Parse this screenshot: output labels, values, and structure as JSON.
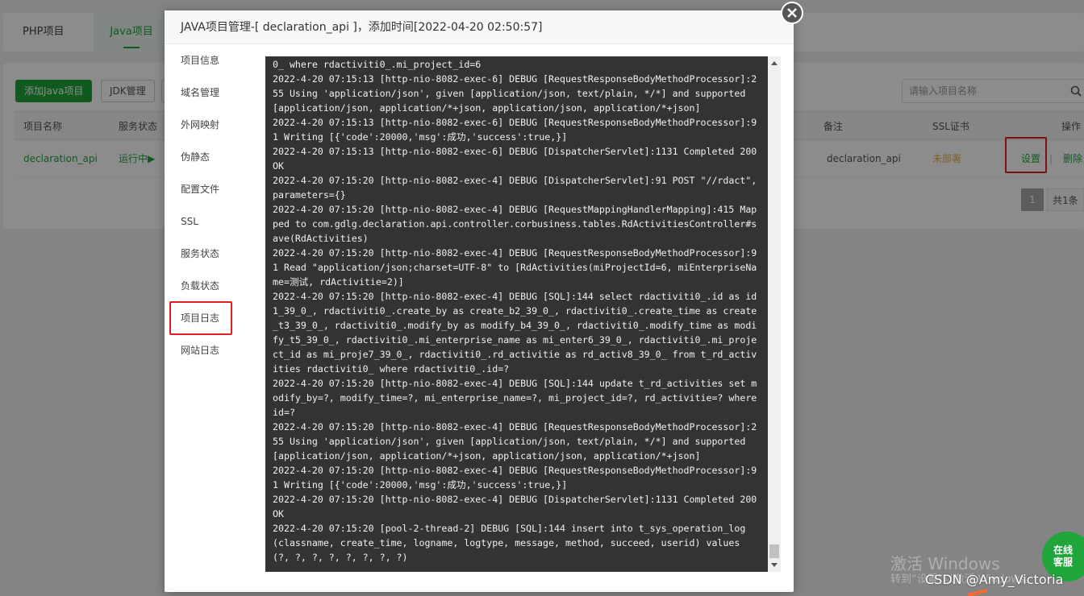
{
  "tabs": {
    "php": "PHP项目",
    "java": "Java项目"
  },
  "toolbar": {
    "add_java": "添加Java项目",
    "jdk": "JDK管理"
  },
  "search": {
    "placeholder": "请输入项目名称"
  },
  "table": {
    "headers": {
      "name": "项目名称",
      "status": "服务状态",
      "remark": "备注",
      "ssl": "SSL证书",
      "actions": "操作"
    },
    "row": {
      "name": "declaration_api",
      "status": "运行中▶",
      "remark": "declaration_api",
      "ssl": "未部署",
      "settings": "设置",
      "separator": "|",
      "delete": "删除"
    }
  },
  "pagination": {
    "page": "1",
    "total": "共1条"
  },
  "modal": {
    "title": "JAVA项目管理-[ declaration_api ]，添加时间[2022-04-20 02:50:57]",
    "nav": [
      "项目信息",
      "域名管理",
      "外网映射",
      "伪静态",
      "配置文件",
      "SSL",
      "服务状态",
      "负载状态",
      "项目日志",
      "网站日志"
    ],
    "active_nav": "项目日志",
    "log_lines": [
      "0_ where rdactiviti0_.mi_project_id=6",
      "2022-4-20 07:15:13 [http-nio-8082-exec-6] DEBUG [RequestResponseBodyMethodProcessor]:255 Using 'application/json', given [application/json, text/plain, */*] and supported [application/json, application/*+json, application/json, application/*+json]",
      "2022-4-20 07:15:13 [http-nio-8082-exec-6] DEBUG [RequestResponseBodyMethodProcessor]:91 Writing [{'code':20000,'msg':成功,'success':true,}]",
      "2022-4-20 07:15:13 [http-nio-8082-exec-6] DEBUG [DispatcherServlet]:1131 Completed 200 OK",
      "2022-4-20 07:15:20 [http-nio-8082-exec-4] DEBUG [DispatcherServlet]:91 POST \"//rdact\", parameters={}",
      "2022-4-20 07:15:20 [http-nio-8082-exec-4] DEBUG [RequestMappingHandlerMapping]:415 Mapped to com.gdlg.declaration.api.controller.corbusiness.tables.RdActivitiesController#save(RdActivities)",
      "2022-4-20 07:15:20 [http-nio-8082-exec-4] DEBUG [RequestResponseBodyMethodProcessor]:91 Read \"application/json;charset=UTF-8\" to [RdActivities(miProjectId=6, miEnterpriseName=测试, rdActivitie=2)]",
      "2022-4-20 07:15:20 [http-nio-8082-exec-4] DEBUG [SQL]:144 select rdactiviti0_.id as id1_39_0_, rdactiviti0_.create_by as create_b2_39_0_, rdactiviti0_.create_time as create_t3_39_0_, rdactiviti0_.modify_by as modify_b4_39_0_, rdactiviti0_.modify_time as modify_t5_39_0_, rdactiviti0_.mi_enterprise_name as mi_enter6_39_0_, rdactiviti0_.mi_project_id as mi_proje7_39_0_, rdactiviti0_.rd_activitie as rd_activ8_39_0_ from t_rd_activities rdactiviti0_ where rdactiviti0_.id=?",
      "2022-4-20 07:15:20 [http-nio-8082-exec-4] DEBUG [SQL]:144 update t_rd_activities set modify_by=?, modify_time=?, mi_enterprise_name=?, mi_project_id=?, rd_activitie=? where id=?",
      "2022-4-20 07:15:20 [http-nio-8082-exec-4] DEBUG [RequestResponseBodyMethodProcessor]:255 Using 'application/json', given [application/json, text/plain, */*] and supported [application/json, application/*+json, application/json, application/*+json]",
      "2022-4-20 07:15:20 [http-nio-8082-exec-4] DEBUG [RequestResponseBodyMethodProcessor]:91 Writing [{'code':20000,'msg':成功,'success':true,}]",
      "2022-4-20 07:15:20 [http-nio-8082-exec-4] DEBUG [DispatcherServlet]:1131 Completed 200 OK",
      "2022-4-20 07:15:20 [pool-2-thread-2] DEBUG [SQL]:144 insert into t_sys_operation_log (classname, create_time, logname, logtype, message, method, succeed, userid) values (?, ?, ?, ?, ?, ?, ?, ?)"
    ]
  },
  "watermark": {
    "line1": "激活 Windows",
    "line2": "转到“设置”以激活 Windows。"
  },
  "csdn": "CSDN @Amy_Victoria",
  "kefu": {
    "line1": "在线",
    "line2": "客服"
  },
  "colors": {
    "accent": "#20a53a",
    "highlight": "#e02020",
    "log_bg": "#333333",
    "warning": "#f0ad4e"
  }
}
